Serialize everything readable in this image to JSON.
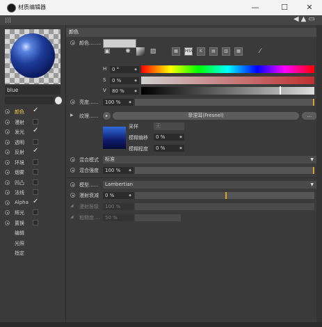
{
  "window": {
    "title": "材质编辑器",
    "min_symbol": "—",
    "max_symbol": "☐",
    "close_symbol": "✕"
  },
  "material": {
    "name": "blue"
  },
  "channels": [
    {
      "label": "颜色",
      "checked": true,
      "active": true
    },
    {
      "label": "漫射",
      "checked": false
    },
    {
      "label": "发光",
      "checked": true
    },
    {
      "label": "透明",
      "checked": false
    },
    {
      "label": "反射",
      "checked": true
    },
    {
      "label": "环境",
      "checked": false
    },
    {
      "label": "烟雾",
      "checked": false
    },
    {
      "label": "凹凸",
      "checked": false
    },
    {
      "label": "法线",
      "checked": false
    },
    {
      "label": "Alpha",
      "checked": true
    },
    {
      "label": "辉光",
      "checked": false
    },
    {
      "label": "置换",
      "checked": false
    }
  ],
  "sub_items": [
    "编辑",
    "光照",
    "指定"
  ],
  "section": {
    "title": "颜色"
  },
  "color": {
    "label": "颜色",
    "dots": "........",
    "swatch": "#cfcfcf",
    "H": {
      "label": "H",
      "value": "0 °"
    },
    "S": {
      "label": "S",
      "value": "0 %"
    },
    "V": {
      "label": "V",
      "value": "80 %",
      "position": 0.8
    },
    "mode_labels": [
      "HSV"
    ],
    "picker_icon": "eyedropper-icon"
  },
  "brightness": {
    "label": "亮度",
    "dots": "......",
    "value": "100 %"
  },
  "texture": {
    "label": "纹理",
    "dots": "......",
    "shader": "菲涅耳(Fresnel)",
    "more": "...",
    "sampling_label": "采样",
    "sampling_value": "无",
    "blur_offset_label": "模糊偏移",
    "blur_offset_value": "0 %",
    "blur_scale_label": "模糊程度",
    "blur_scale_value": "0 %"
  },
  "mix_mode": {
    "label": "混合模式",
    "value": "标准"
  },
  "mix_strength": {
    "label": "混合强度",
    "value": "100 %"
  },
  "model": {
    "label": "模型",
    "dots": "......",
    "value": "Lambertian"
  },
  "diffuse_falloff": {
    "label": "漫射衰减",
    "value": "0 %"
  },
  "diffuse_level": {
    "label": "漫射层级",
    "value": "100 %"
  },
  "roughness": {
    "label": "粗糙度",
    "dots": "....",
    "value": "50 %"
  },
  "colors": {
    "accent": "#e0a030",
    "active_label": "#f2c94c"
  }
}
